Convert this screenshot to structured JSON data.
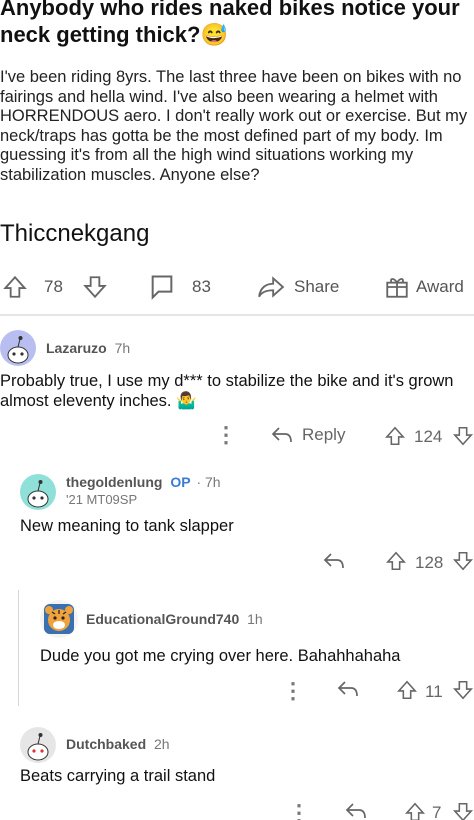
{
  "post": {
    "title": "Anybody who rides naked bikes notice your neck getting thick?😅",
    "body": "I've been riding 8yrs. The last three have been on bikes with no fairings and hella wind. I've also been wearing a helmet with HORRENDOUS aero. I don't really work out or exercise. But my neck/traps has gotta be the most defined part of my body. Im guessing it's from all the high wind situations working my stabilization muscles. Anyone else?",
    "flair": "Thiccnekgang",
    "votes": "78",
    "comments": "83",
    "share_label": "Share",
    "award_label": "Award"
  },
  "comments": [
    {
      "user": "Lazaruzo",
      "time": "7h",
      "text": "Probably true, I use my d*** to stabilize the bike and it's grown almost eleventy inches. 🤷‍♂️",
      "reply_label": "Reply",
      "votes": "124"
    },
    {
      "user": "thegoldenlung",
      "op": "OP",
      "time": "7h",
      "flair": "'21 MT09SP",
      "text": "New meaning to tank slapper",
      "votes": "128"
    },
    {
      "user": "EducationalGround740",
      "time": "1h",
      "text": "Dude you got me crying over here. Bahahhahaha",
      "votes": "11"
    },
    {
      "user": "Dutchbaked",
      "time": "2h",
      "text": "Beats carrying a trail stand",
      "votes": "7"
    }
  ],
  "colors": {
    "op_blue": "#3a7bd5",
    "avatar_lavender": "#b8bff0",
    "avatar_teal": "#8fe0d8"
  },
  "icons": [
    "upvote-icon",
    "downvote-icon",
    "comment-icon",
    "share-icon",
    "award-icon",
    "reply-icon",
    "more-icon",
    "snoo-avatar-icon"
  ]
}
